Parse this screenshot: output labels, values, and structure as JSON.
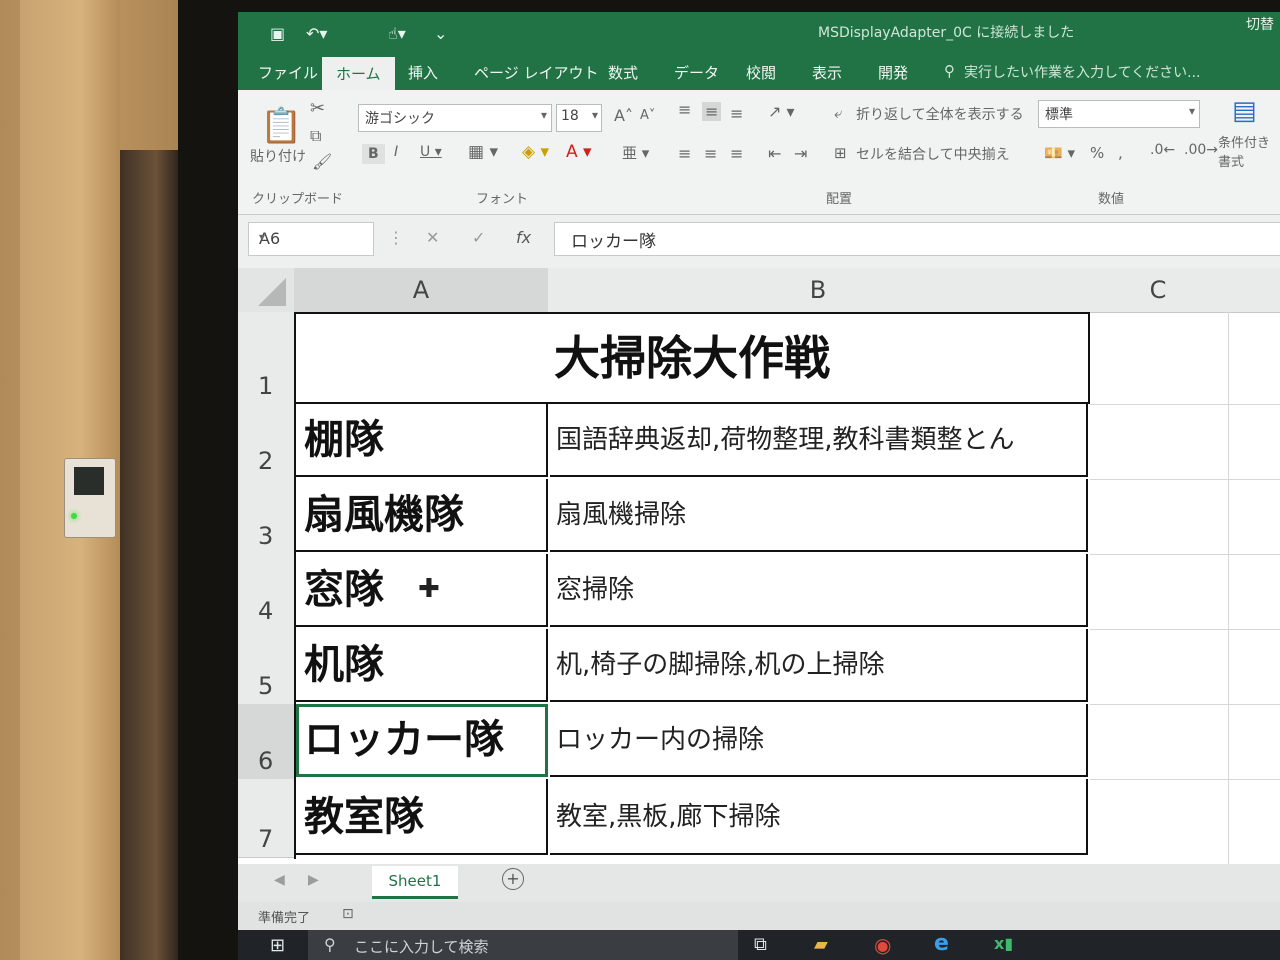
{
  "window": {
    "title": "MSDisplayAdapter_0C に接続しました",
    "right_text": "切替"
  },
  "menu": {
    "tabs": [
      "ファイル",
      "ホーム",
      "挿入",
      "ページ レイアウト",
      "数式",
      "データ",
      "校閲",
      "表示",
      "開発"
    ],
    "tell_me": "実行したい作業を入力してください..."
  },
  "ribbon": {
    "paste": "貼り付け",
    "clipboard": "クリップボード",
    "font_name": "游ゴシック",
    "font_size": "18",
    "font_group": "フォント",
    "wrap_text": "折り返して全体を表示する",
    "merge_center": "セルを結合して中央揃え",
    "alignment_group": "配置",
    "number_format": "標準",
    "number_group": "数値",
    "conditional_format": "条件付き書式"
  },
  "formula_bar": {
    "name_box": "A6",
    "content": "ロッカー隊"
  },
  "columns": [
    "A",
    "B",
    "C"
  ],
  "rows": [
    {
      "num": "1",
      "title": "大掃除大作戦"
    },
    {
      "num": "2",
      "team": "棚隊",
      "task": "国語辞典返却,荷物整理,教科書類整とん"
    },
    {
      "num": "3",
      "team": "扇風機隊",
      "task": "扇風機掃除"
    },
    {
      "num": "4",
      "team": "窓隊",
      "task": "窓掃除"
    },
    {
      "num": "5",
      "team": "机隊",
      "task": "机,椅子の脚掃除,机の上掃除"
    },
    {
      "num": "6",
      "team": "ロッカー隊",
      "task": "ロッカー内の掃除"
    },
    {
      "num": "7",
      "team": "教室隊",
      "task": "教室,黒板,廊下掃除"
    }
  ],
  "sheet_tab": "Sheet1",
  "status": "準備完了",
  "taskbar": {
    "search_placeholder": "ここに入力して検索"
  }
}
